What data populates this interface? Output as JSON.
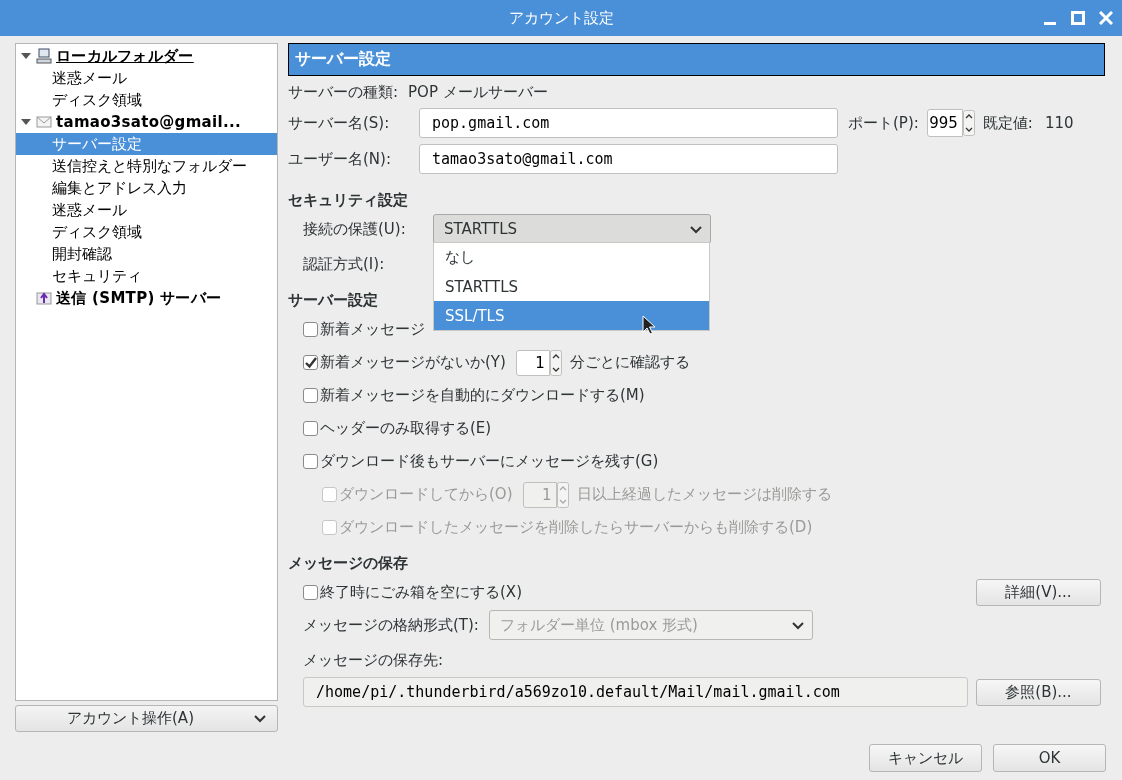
{
  "window": {
    "title": "アカウント設定"
  },
  "tree": [
    {
      "label": "ローカルフォルダー",
      "expanded": true,
      "underlined": true,
      "selected": false,
      "children": [
        {
          "label": "迷惑メール",
          "selected": false
        },
        {
          "label": "ディスク領域",
          "selected": false
        }
      ]
    },
    {
      "label": "tamao3sato@gmail...",
      "expanded": true,
      "underlined": false,
      "selected": false,
      "children": [
        {
          "label": "サーバー設定",
          "selected": true
        },
        {
          "label": "送信控えと特別なフォルダー",
          "selected": false
        },
        {
          "label": "編集とアドレス入力",
          "selected": false
        },
        {
          "label": "迷惑メール",
          "selected": false
        },
        {
          "label": "ディスク領域",
          "selected": false
        },
        {
          "label": "開封確認",
          "selected": false
        },
        {
          "label": "セキュリティ",
          "selected": false
        }
      ]
    },
    {
      "label": "送信 (SMTP) サーバー",
      "underlined": false,
      "selected": false
    }
  ],
  "account_actions": {
    "label": "アカウント操作(A)"
  },
  "panel": {
    "title": "サーバー設定",
    "server_type": {
      "label": "サーバーの種類:",
      "value": "POP メールサーバー"
    },
    "server_name": {
      "label": "サーバー名(S):",
      "value": "pop.gmail.com"
    },
    "port": {
      "label": "ポート(P):",
      "value": "995",
      "default_label": "既定値:",
      "default_value": "110"
    },
    "user_name": {
      "label": "ユーザー名(N):",
      "value": "tamao3sato@gmail.com"
    },
    "security": {
      "heading": "セキュリティ設定",
      "connection_label": "接続の保護(U):",
      "connection_value": "STARTTLS",
      "auth_label": "認証方式(I):",
      "options": [
        {
          "label": "なし",
          "selected": false
        },
        {
          "label": "STARTTLS",
          "selected": false
        },
        {
          "label": "SSL/TLS",
          "selected": true
        }
      ]
    },
    "server_settings": {
      "heading": "サーバー設定",
      "options": [
        {
          "kind": "check",
          "label": "新着メッセージ",
          "checked": false,
          "disabled": false
        },
        {
          "kind": "spin",
          "label": "新着メッセージがないか(Y)",
          "checked": true,
          "disabled": false,
          "value": "1",
          "suffix": "分ごとに確認する"
        },
        {
          "kind": "check",
          "label": "新着メッセージを自動的にダウンロードする(M)",
          "checked": false,
          "disabled": false
        },
        {
          "kind": "check",
          "label": "ヘッダーのみ取得する(E)",
          "checked": false,
          "disabled": false
        },
        {
          "kind": "check",
          "label": "ダウンロード後もサーバーにメッセージを残す(G)",
          "checked": false,
          "disabled": false,
          "children": [
            {
              "kind": "spin",
              "label": "ダウンロードしてから(O)",
              "checked": false,
              "disabled": true,
              "value": "1",
              "suffix": "日以上経過したメッセージは削除する"
            },
            {
              "kind": "check",
              "label": "ダウンロードしたメッセージを削除したらサーバーからも削除する(D)",
              "checked": false,
              "disabled": true
            }
          ]
        }
      ]
    },
    "storage": {
      "heading": "メッセージの保存",
      "empty_trash": {
        "label": "終了時にごみ箱を空にする(X)",
        "checked": false
      },
      "advanced_button": "詳細(V)...",
      "format_label": "メッセージの格納形式(T):",
      "format_value": "フォルダー単位 (mbox 形式)",
      "location_label": "メッセージの保存先:",
      "location_value": "/home/pi/.thunderbird/a569zo10.default/Mail/mail.gmail.com",
      "browse_button": "参照(B)..."
    }
  },
  "buttons": [
    {
      "label": "キャンセル"
    },
    {
      "label": "OK"
    }
  ]
}
